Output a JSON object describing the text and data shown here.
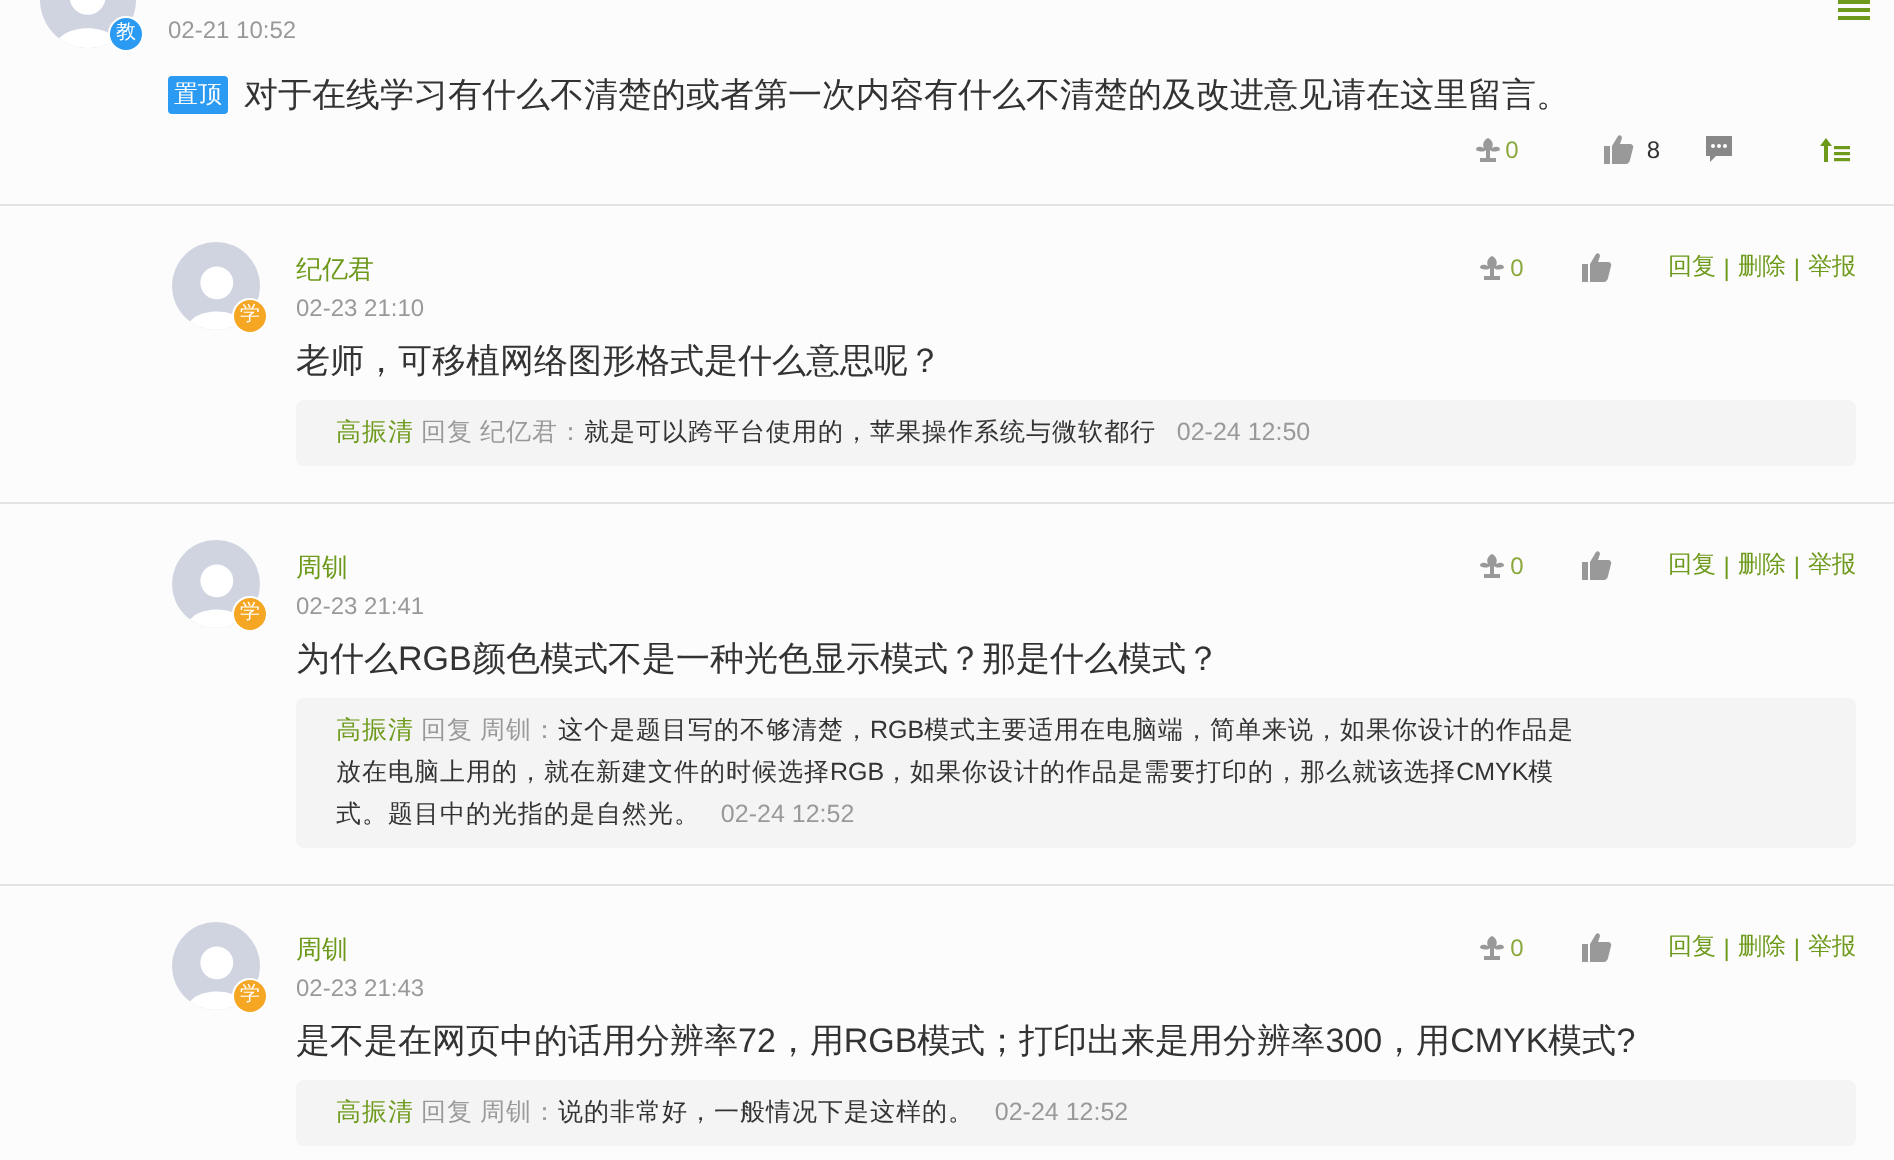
{
  "pinned_post": {
    "avatar_badge": "教",
    "date": "02-21 10:52",
    "pin_tag": "置顶",
    "content": "对于在线学习有什么不清楚的或者第一次内容有什么不清楚的及改进意见请在这里留言。",
    "flower_count": "0",
    "like_count": "8"
  },
  "replies": [
    {
      "name": "纪亿君",
      "avatar_badge": "学",
      "date": "02-23 21:10",
      "content": "老师，可移植网络图形格式是什么意思呢？",
      "flower_count": "0",
      "actions": [
        "回复",
        "删除",
        "举报"
      ],
      "action_separator": "|",
      "sub_reply": {
        "author": "高振清",
        "verb": "回复",
        "target": "纪亿君",
        "colon": "：",
        "text": "就是可以跨平台使用的，苹果操作系统与微软都行",
        "date": "02-24 12:50"
      }
    },
    {
      "name": "周钏",
      "avatar_badge": "学",
      "date": "02-23 21:41",
      "content": "为什么RGB颜色模式不是一种光色显示模式？那是什么模式？",
      "flower_count": "0",
      "actions": [
        "回复",
        "删除",
        "举报"
      ],
      "action_separator": "|",
      "sub_reply": {
        "author": "高振清",
        "verb": "回复",
        "target": "周钏",
        "colon": "：",
        "text": "这个是题目写的不够清楚，RGB模式主要适用在电脑端，简单来说，如果你设计的作品是放在电脑上用的，就在新建文件的时候选择RGB，如果你设计的作品是需要打印的，那么就该选择CMYK模式。题目中的光指的是自然光。",
        "date": "02-24 12:52"
      }
    },
    {
      "name": "周钏",
      "avatar_badge": "学",
      "date": "02-23 21:43",
      "content": "是不是在网页中的话用分辨率72，用RGB模式；打印出来是用分辨率300，用CMYK模式?",
      "flower_count": "0",
      "actions": [
        "回复",
        "删除",
        "举报"
      ],
      "action_separator": "|",
      "sub_reply": {
        "author": "高振清",
        "verb": "回复",
        "target": "周钏",
        "colon": "：",
        "text": "说的非常好，一般情况下是这样的。",
        "date": "02-24 12:52"
      }
    }
  ]
}
